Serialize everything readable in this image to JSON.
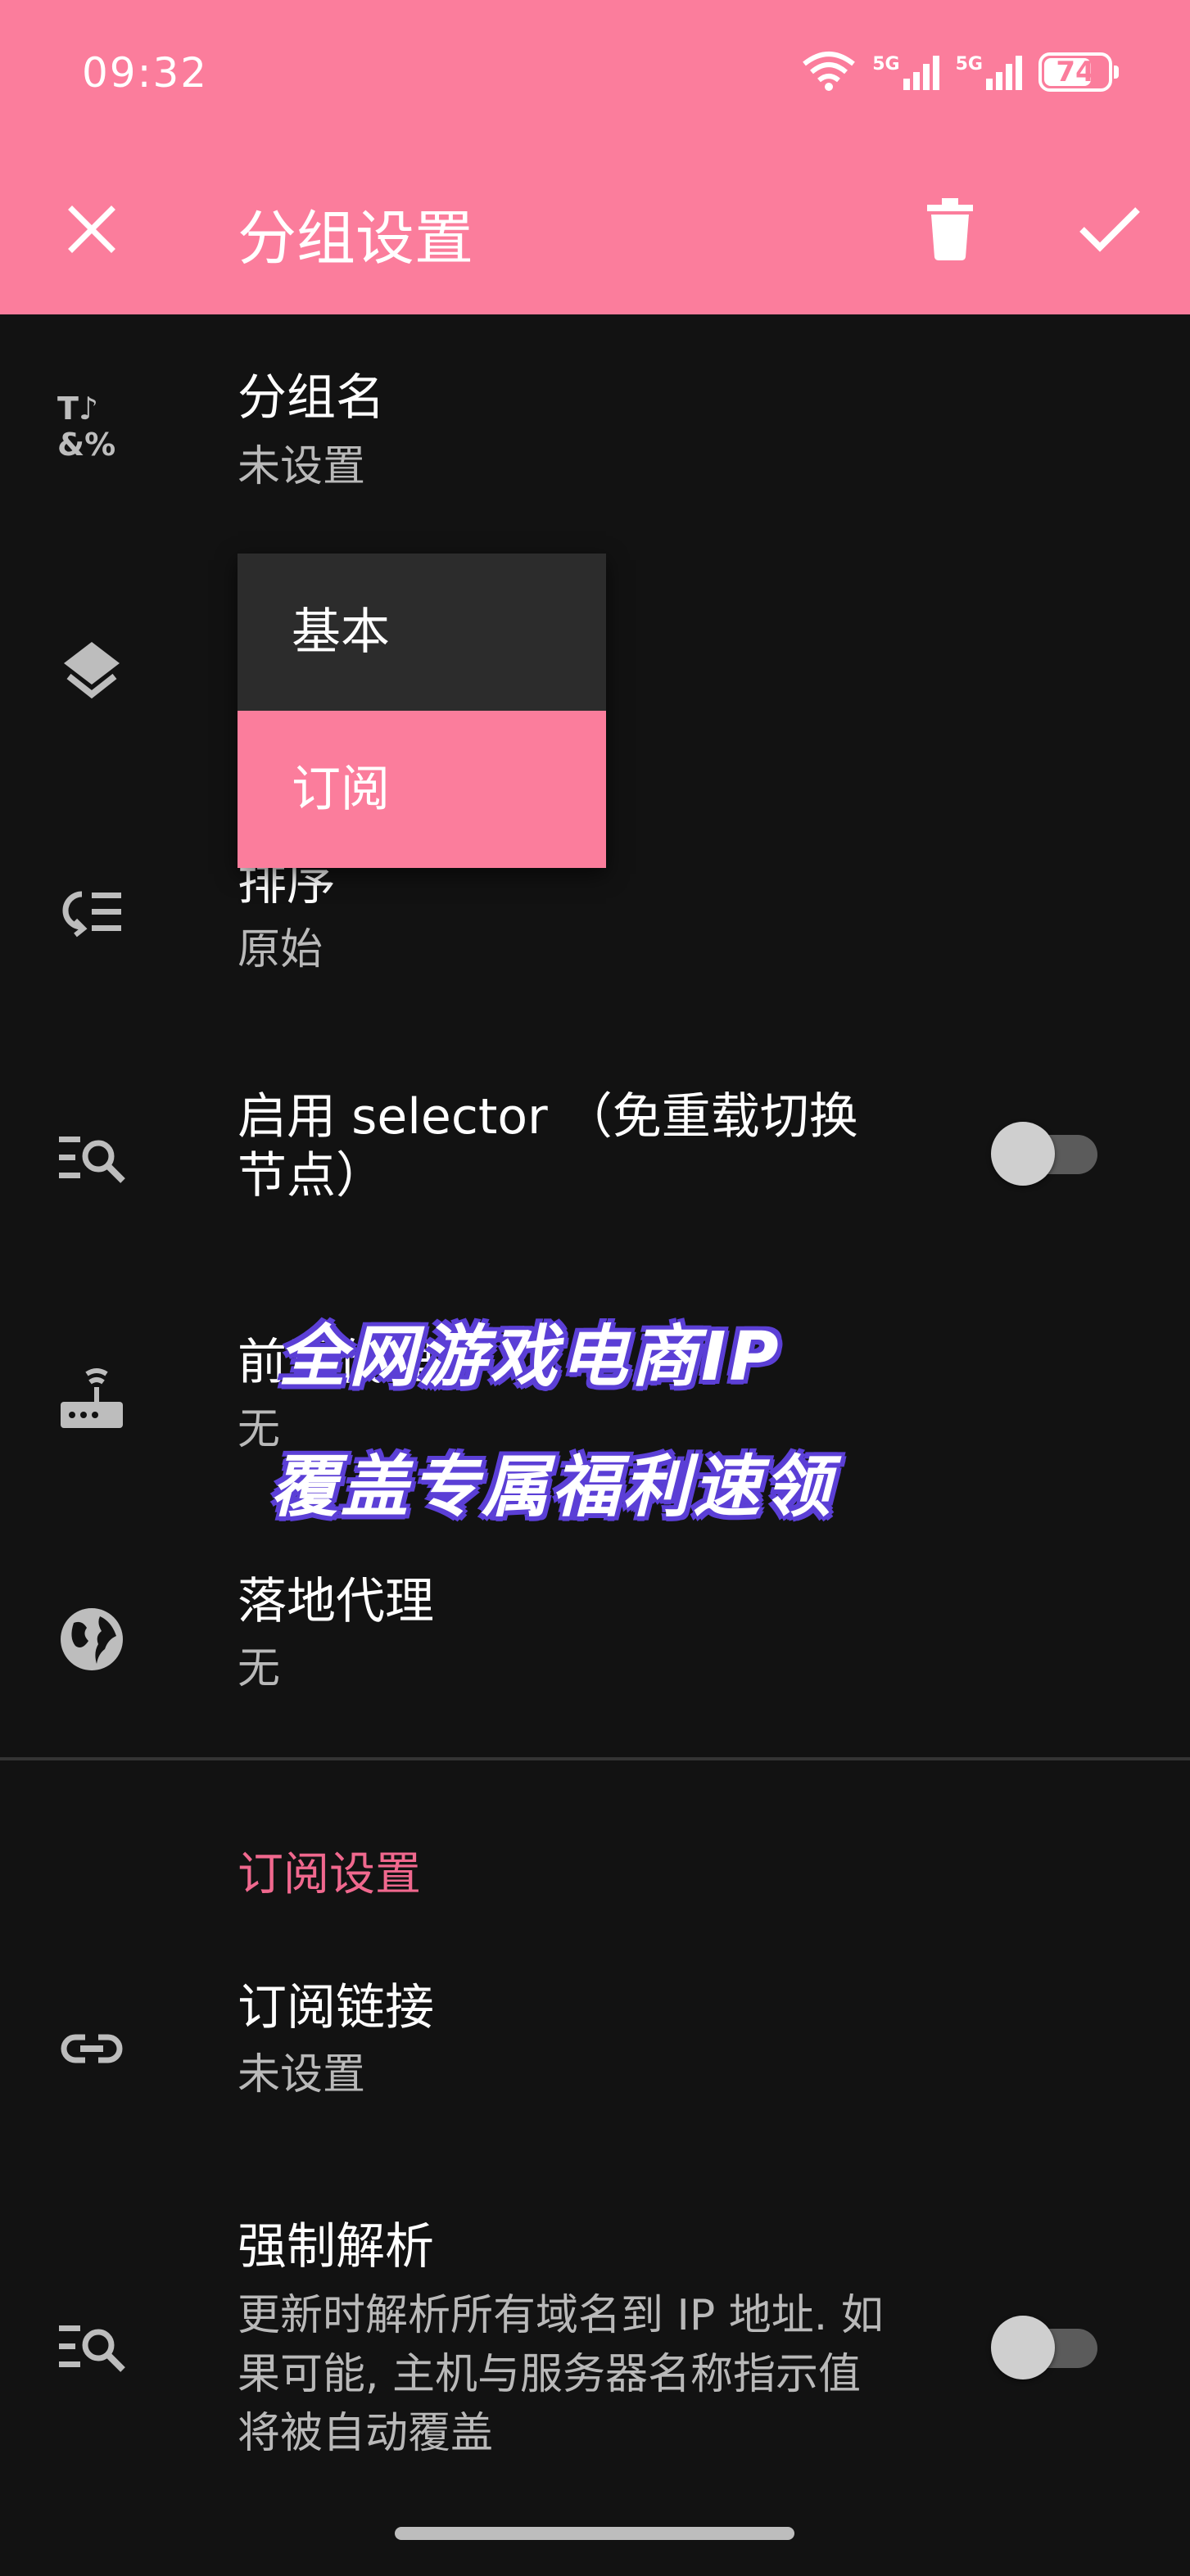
{
  "status": {
    "time": "09:32",
    "battery": "74",
    "net1": "5G",
    "net2": "5G",
    "wifi_tag": "7"
  },
  "app_bar": {
    "title": "分组设置"
  },
  "prefs": {
    "group_name": {
      "title": "分组名",
      "summary": "未设置"
    },
    "sort": {
      "title": "排序",
      "summary": "原始"
    },
    "selector": {
      "title_line1": "启用 selector （免重载切换",
      "title_line2": "节点）"
    },
    "front_proxy": {
      "title": "前置代理",
      "summary": "无"
    },
    "landing_proxy": {
      "title": "落地代理",
      "summary": "无"
    },
    "subscription_link": {
      "title": "订阅链接",
      "summary": "未设置"
    },
    "force_resolve": {
      "title": "强制解析",
      "summary_line1": "更新时解析所有域名到 IP 地址. 如",
      "summary_line2": "果可能, 主机与服务器名称指示值",
      "summary_line3": "将被自动覆盖"
    }
  },
  "section": {
    "subscription_settings": "订阅设置"
  },
  "dropdown": {
    "options": [
      "基本",
      "订阅"
    ],
    "selected": "订阅"
  },
  "ad": {
    "line1": "全网游戏电商IP",
    "line2": "覆盖专属福利速领"
  },
  "colors": {
    "accent": "#fb7d9c",
    "section": "#f0688e",
    "background": "#121212"
  }
}
